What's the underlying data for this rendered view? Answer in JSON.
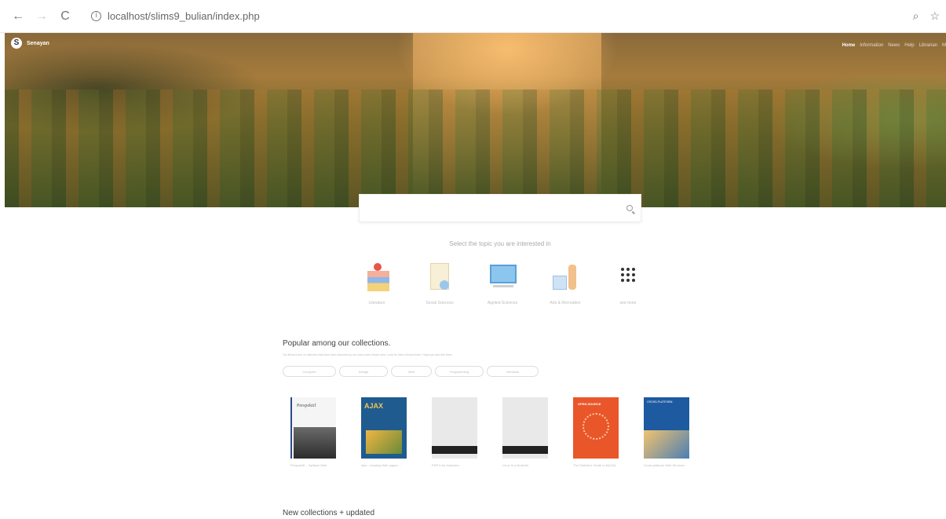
{
  "browser": {
    "back_icon": "←",
    "forward_icon": "→",
    "reload_icon": "C",
    "info_icon": "i",
    "url": "localhost/slims9_bulian/index.php",
    "zoom_icon": "⌕",
    "star_icon": "☆"
  },
  "site": {
    "logo_glyph": "S",
    "name": "Senayan"
  },
  "topnav": {
    "items": [
      "Home",
      "Information",
      "News",
      "Help",
      "Librarian",
      "M"
    ]
  },
  "search": {
    "placeholder": ""
  },
  "topics": {
    "prompt": "Select the topic you are interested in",
    "items": [
      {
        "label": "Literature",
        "icon": "literature-icon"
      },
      {
        "label": "Social Sciences",
        "icon": "social-sciences-icon"
      },
      {
        "label": "Applied Sciences",
        "icon": "applied-sciences-icon"
      },
      {
        "label": "Arts & Recreation",
        "icon": "arts-recreation-icon"
      },
      {
        "label": "see more",
        "icon": "grid-icon"
      }
    ]
  },
  "popular": {
    "title": "Popular among our collections.",
    "description": "Our library's line of collection that have been favoured by our users were shown here. Look for them. Borrow them. Hope you also like them",
    "filters": [
      "Computer",
      "Design",
      "Web",
      "Programming",
      "Windows"
    ],
    "books": [
      {
        "cover_title": "Perspektif",
        "title": "Perspektif ... Aplikasi Web"
      },
      {
        "cover_title": "AJAX",
        "title": "Ajax : creating Web pages ..."
      },
      {
        "cover_title": "",
        "title": "PHP 5 for dummies"
      },
      {
        "cover_title": "",
        "title": "Linux In a Nutshell"
      },
      {
        "cover_title": "OPEN SOURCE",
        "title": "The Definitive Guide to MySQL"
      },
      {
        "cover_title": "CROSS-PLATFORM",
        "title": "Cross-platform Web Services"
      }
    ]
  },
  "new_collections": {
    "title": "New collections + updated"
  }
}
